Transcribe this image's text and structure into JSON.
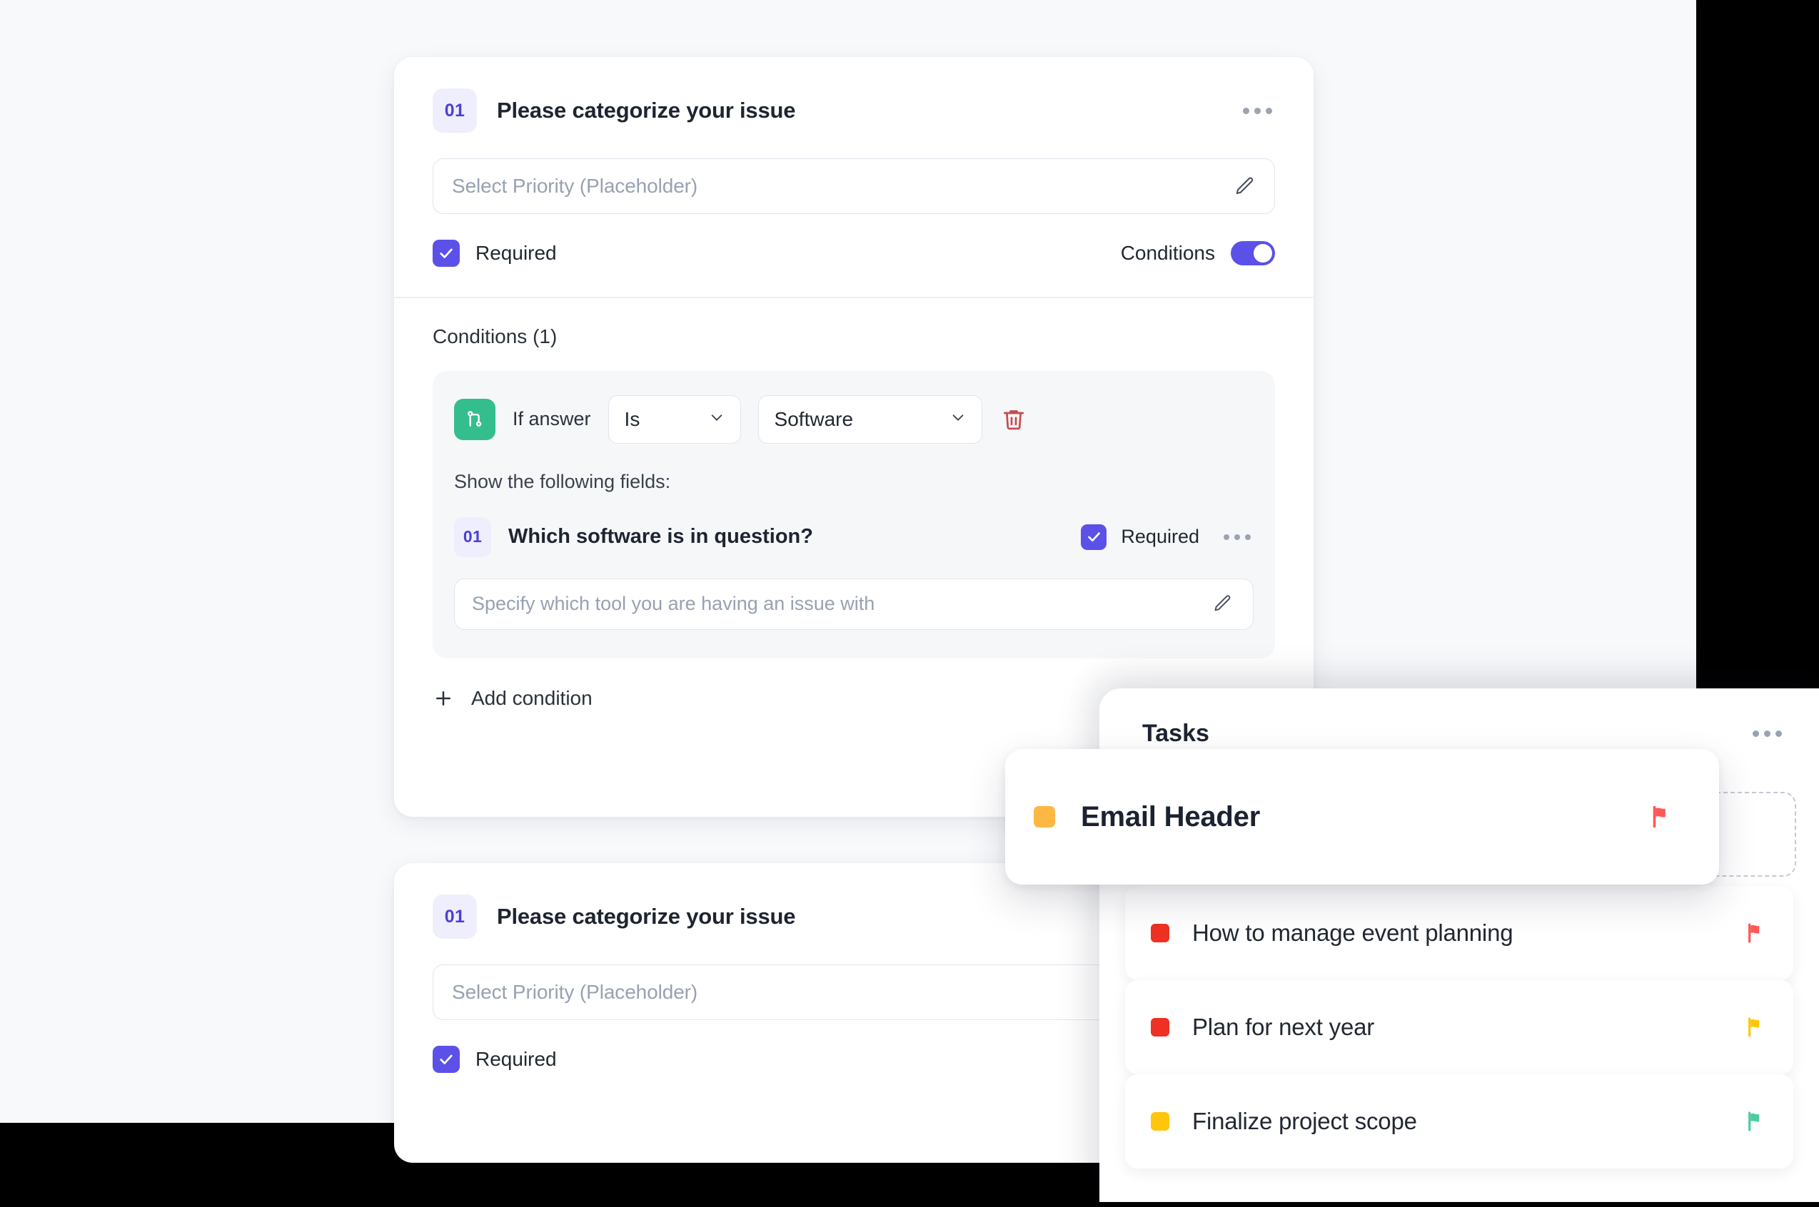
{
  "question_cards": [
    {
      "number": "01",
      "title": "Please categorize your issue",
      "field_placeholder": "Select Priority (Placeholder)",
      "required_label": "Required",
      "conditions_label": "Conditions",
      "conditions_toggle_on": true,
      "edit_icon": "pencil-icon",
      "menu_icon": "more-options-icon",
      "conditions_section": {
        "heading": "Conditions (1)",
        "branch_icon": "git-branch-icon",
        "if_label": "If answer",
        "operator": "Is",
        "value": "Software",
        "delete_icon": "trash-icon",
        "show_fields_label": "Show the following fields:",
        "nested_question": {
          "number": "01",
          "title": "Which software is in question?",
          "required_label": "Required",
          "field_placeholder": "Specify which tool you are having an issue with",
          "menu_icon": "more-options-icon",
          "edit_icon": "pencil-icon"
        }
      },
      "add_condition_label": "Add condition",
      "add_condition_icon": "plus-icon"
    },
    {
      "number": "01",
      "title": "Please categorize your issue",
      "field_placeholder": "Select Priority (Placeholder)",
      "required_label": "Required",
      "edit_icon": "pencil-icon",
      "menu_icon": "more-options-icon"
    }
  ],
  "tasks_panel": {
    "title": "Tasks",
    "menu_icon": "more-options-icon",
    "dragging_task": {
      "label": "Email Header",
      "swatch_color": "#FDB743",
      "flag_color": "#FC5858",
      "flag_icon": "flag-icon"
    },
    "items": [
      {
        "label": "How to manage event planning",
        "swatch_color": "#EE3124",
        "flag_color": "#FC5858",
        "flag_icon": "flag-icon"
      },
      {
        "label": "Plan for next year",
        "swatch_color": "#EE3124",
        "flag_color": "#FFC60B",
        "flag_icon": "flag-icon"
      },
      {
        "label": "Finalize project scope",
        "swatch_color": "#FFC60B",
        "flag_color": "#4ECCA0",
        "flag_icon": "flag-icon"
      }
    ]
  },
  "colors": {
    "accent_indigo": "#5B51E8",
    "badge_bg": "#EFEEFC",
    "badge_text": "#4B3FD6",
    "branch_green": "#35BE8D",
    "trash_red": "#C74B4B",
    "panel_bg": "#F8F9FB",
    "condition_box_bg": "#F6F7F9"
  }
}
